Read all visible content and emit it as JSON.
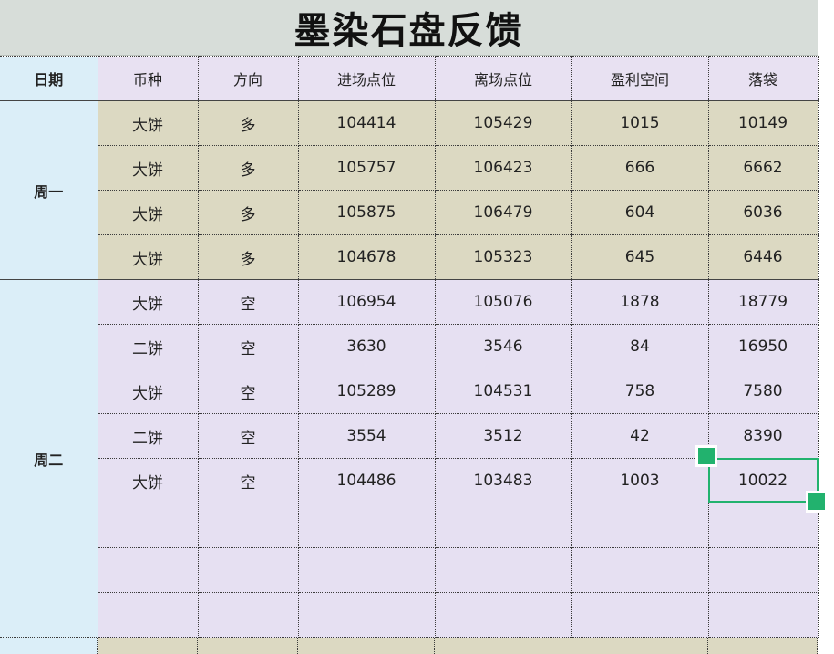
{
  "title": "墨染石盘反馈",
  "columns": [
    "日期",
    "币种",
    "方向",
    "进场点位",
    "离场点位",
    "盈利空间",
    "落袋"
  ],
  "monday": {
    "label": "周一",
    "rows": [
      {
        "coin": "大饼",
        "direction": "多",
        "entry": "104414",
        "exit": "105429",
        "profit": "1015",
        "pocket": "10149"
      },
      {
        "coin": "大饼",
        "direction": "多",
        "entry": "105757",
        "exit": "106423",
        "profit": "666",
        "pocket": "6662"
      },
      {
        "coin": "大饼",
        "direction": "多",
        "entry": "105875",
        "exit": "106479",
        "profit": "604",
        "pocket": "6036"
      },
      {
        "coin": "大饼",
        "direction": "多",
        "entry": "104678",
        "exit": "105323",
        "profit": "645",
        "pocket": "6446"
      }
    ]
  },
  "tuesday": {
    "label": "周二",
    "rows": [
      {
        "coin": "大饼",
        "direction": "空",
        "entry": "106954",
        "exit": "105076",
        "profit": "1878",
        "pocket": "18779"
      },
      {
        "coin": "二饼",
        "direction": "空",
        "entry": "3630",
        "exit": "3546",
        "profit": "84",
        "pocket": "16950"
      },
      {
        "coin": "大饼",
        "direction": "空",
        "entry": "105289",
        "exit": "104531",
        "profit": "758",
        "pocket": "7580"
      },
      {
        "coin": "二饼",
        "direction": "空",
        "entry": "3554",
        "exit": "3512",
        "profit": "42",
        "pocket": "8390"
      },
      {
        "coin": "大饼",
        "direction": "空",
        "entry": "104486",
        "exit": "103483",
        "profit": "1003",
        "pocket": "10022"
      }
    ]
  },
  "colors": {
    "title_bg": "#d7ddd9",
    "date_col_bg": "#dbeef8",
    "header_bg": "#e8e1f2",
    "monday_bg": "#dcd9c2",
    "tuesday_bg": "#e6e0f2",
    "selection": "#22b26e"
  },
  "selected_cell": {
    "row_day": "周二",
    "row_index": 4,
    "column": "落袋"
  }
}
